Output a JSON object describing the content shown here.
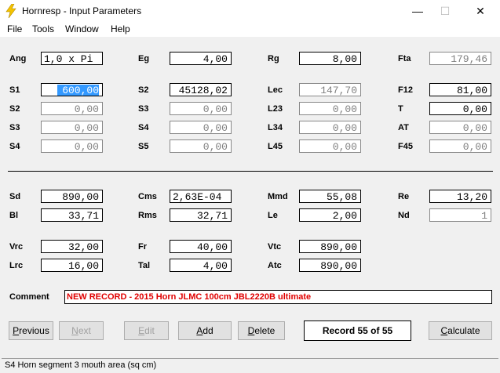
{
  "window": {
    "title": "Hornresp - Input Parameters"
  },
  "menu": [
    "File",
    "Tools",
    "Window",
    "Help"
  ],
  "fields": [
    {
      "id": "ang",
      "label": "Ang",
      "value": "1,0 x Pi",
      "style": "left"
    },
    {
      "id": "eg",
      "label": "Eg",
      "value": "4,00"
    },
    {
      "id": "rg",
      "label": "Rg",
      "value": "8,00"
    },
    {
      "id": "fta",
      "label": "Fta",
      "value": "179,46",
      "style": "gray"
    },
    {
      "id": "s1",
      "label": "S1",
      "value": "600,00",
      "style": "sel"
    },
    {
      "id": "s2b",
      "label": "S2",
      "value": "45128,02"
    },
    {
      "id": "lec",
      "label": "Lec",
      "value": "147,70",
      "style": "gray"
    },
    {
      "id": "f12",
      "label": "F12",
      "value": "81,00"
    },
    {
      "id": "s2",
      "label": "S2",
      "value": "0,00",
      "style": "gray"
    },
    {
      "id": "s3b",
      "label": "S3",
      "value": "0,00",
      "style": "gray"
    },
    {
      "id": "l23",
      "label": "L23",
      "value": "0,00",
      "style": "gray"
    },
    {
      "id": "t",
      "label": "T",
      "value": "0,00"
    },
    {
      "id": "s3",
      "label": "S3",
      "value": "0,00",
      "style": "gray"
    },
    {
      "id": "s4b",
      "label": "S4",
      "value": "0,00",
      "style": "gray"
    },
    {
      "id": "l34",
      "label": "L34",
      "value": "0,00",
      "style": "gray"
    },
    {
      "id": "at",
      "label": "AT",
      "value": "0,00",
      "style": "gray"
    },
    {
      "id": "s4",
      "label": "S4",
      "value": "0,00",
      "style": "gray"
    },
    {
      "id": "s5",
      "label": "S5",
      "value": "0,00",
      "style": "gray"
    },
    {
      "id": "l45",
      "label": "L45",
      "value": "0,00",
      "style": "gray"
    },
    {
      "id": "f45",
      "label": "F45",
      "value": "0,00",
      "style": "gray"
    },
    {
      "id": "sd",
      "label": "Sd",
      "value": "890,00"
    },
    {
      "id": "cms",
      "label": "Cms",
      "value": "2,63E-04",
      "style": "left"
    },
    {
      "id": "mmd",
      "label": "Mmd",
      "value": "55,08"
    },
    {
      "id": "re",
      "label": "Re",
      "value": "13,20"
    },
    {
      "id": "bl",
      "label": "Bl",
      "value": "33,71"
    },
    {
      "id": "rms",
      "label": "Rms",
      "value": "32,71"
    },
    {
      "id": "le",
      "label": "Le",
      "value": "2,00"
    },
    {
      "id": "nd",
      "label": "Nd",
      "value": "1",
      "style": "gray"
    },
    {
      "id": "vrc",
      "label": "Vrc",
      "value": "32,00"
    },
    {
      "id": "fr",
      "label": "Fr",
      "value": "40,00"
    },
    {
      "id": "vtc",
      "label": "Vtc",
      "value": "890,00"
    },
    {
      "id": "lrc",
      "label": "Lrc",
      "value": "16,00"
    },
    {
      "id": "tal",
      "label": "Tal",
      "value": "4,00"
    },
    {
      "id": "atc",
      "label": "Atc",
      "value": "890,00"
    }
  ],
  "comment": {
    "label": "Comment",
    "value": "NEW RECORD - 2015 Horn JLMC 100cm JBL2220B ultimate"
  },
  "buttons": {
    "previous": "Previous",
    "next": "Next",
    "edit": "Edit",
    "add": "Add",
    "delete": "Delete",
    "record": "Record 55 of 55",
    "calculate": "Calculate"
  },
  "status": "S4   Horn segment 3 mouth area  (sq cm)",
  "colors": {
    "selection": "#3399ff",
    "comment_text": "#e00000",
    "accent_icon": "#f5c400"
  }
}
